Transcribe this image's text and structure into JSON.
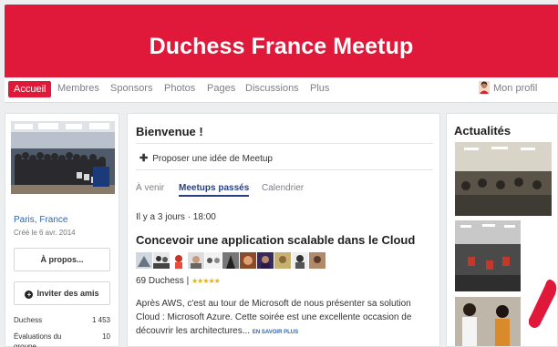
{
  "header": {
    "title": "Duchess France Meetup"
  },
  "nav": {
    "items": [
      "Accueil",
      "Membres",
      "Sponsors",
      "Photos",
      "Pages",
      "Discussions",
      "Plus"
    ],
    "active": "Accueil",
    "profile_label": "Mon profil"
  },
  "sidebar": {
    "location": "Paris, France",
    "created": "Créé le 6 avr. 2014",
    "about_button": "À propos...",
    "invite_button": "Inviter des amis",
    "stats": [
      {
        "label": "Duchess",
        "value": "1 453"
      },
      {
        "label": "Évaluations du",
        "value": "10"
      }
    ],
    "stats_continued": "groupe"
  },
  "main": {
    "welcome": "Bienvenue !",
    "propose": "Proposer une idée de Meetup",
    "tabs": [
      "À venir",
      "Meetups passés",
      "Calendrier"
    ],
    "active_tab": "Meetups passés",
    "event": {
      "when": "Il y a 3 jours · 18:00",
      "title": "Concevoir une application scalable dans le Cloud",
      "attendees_label": "69 Duchess |",
      "stars": "★★★★★",
      "description": "Après AWS, c'est au tour de Microsoft de nous présenter sa solution Cloud : Microsoft Azure. Cette soirée est une excellente occasion de découvrir les architectures...",
      "more": "EN SAVOIR PLUS"
    }
  },
  "news": {
    "title": "Actualités"
  },
  "colors": {
    "brand": "#e0193b",
    "link": "#2b66b6",
    "active_tab": "#2b3f7f"
  },
  "icons": {
    "plus": "plus-icon",
    "profile": "user-avatar-icon"
  }
}
